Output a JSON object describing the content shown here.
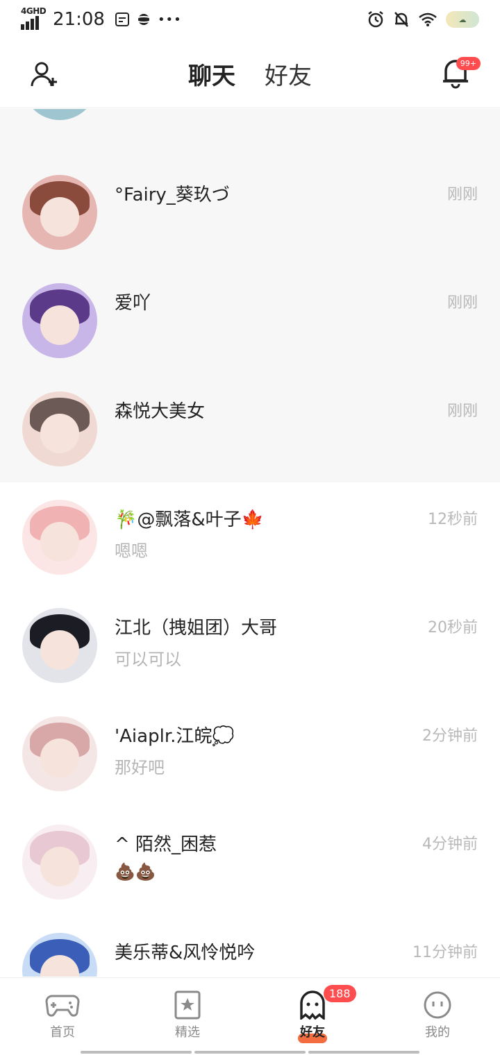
{
  "status": {
    "network": "4GHD",
    "time": "21:08",
    "icons": [
      "sim-icon",
      "planet-icon",
      "more-dots-icon"
    ],
    "right_icons": [
      "alarm-icon",
      "mute-bell-icon",
      "wifi-icon",
      "cloud-badge-icon"
    ],
    "more": "•••"
  },
  "header": {
    "tabs": [
      {
        "label": "聊天",
        "active": true
      },
      {
        "label": "好友",
        "active": false
      }
    ],
    "notification_badge": "99+"
  },
  "conversations": [
    {
      "name": "°Fairy_葵玖づ",
      "time": "刚刚",
      "message": "",
      "pinned": true,
      "colors": [
        "#8a4b3c",
        "#e6b7b2"
      ]
    },
    {
      "name": "爱吖",
      "time": "刚刚",
      "message": "",
      "pinned": true,
      "colors": [
        "#5b3a8a",
        "#c9b6e8"
      ]
    },
    {
      "name": "森悦大美女",
      "time": "刚刚",
      "message": "",
      "pinned": true,
      "colors": [
        "#6b5a55",
        "#f0d9d2"
      ]
    },
    {
      "name": "🎋@飘落&叶子🍁",
      "time": "12秒前",
      "message": "嗯嗯",
      "pinned": false,
      "colors": [
        "#f0b2b2",
        "#fbe5e5"
      ]
    },
    {
      "name": "江北（拽姐团）大哥",
      "time": "20秒前",
      "message": "可以可以",
      "pinned": false,
      "colors": [
        "#1c1c24",
        "#e2e4ea"
      ]
    },
    {
      "name": "'Aiaplr.江皖💭",
      "time": "2分钟前",
      "message": "那好吧",
      "pinned": false,
      "colors": [
        "#d8a8a8",
        "#f5e6e6"
      ]
    },
    {
      "name": "^ 陌然_困惹",
      "time": "4分钟前",
      "message": "💩💩",
      "pinned": false,
      "colors": [
        "#e8c9d3",
        "#f8eef1"
      ]
    },
    {
      "name": "美乐蒂&风怜悦吟",
      "time": "11分钟前",
      "message": "",
      "pinned": false,
      "colors": [
        "#3b5fb8",
        "#c9dcf5"
      ]
    }
  ],
  "nav": [
    {
      "label": "首页",
      "icon": "gamepad-icon",
      "active": false
    },
    {
      "label": "精选",
      "icon": "star-bookmark-icon",
      "active": false
    },
    {
      "label": "好友",
      "icon": "ghost-icon",
      "active": true,
      "badge": "188"
    },
    {
      "label": "我的",
      "icon": "face-icon",
      "active": false
    }
  ],
  "accent": "#f2541f"
}
